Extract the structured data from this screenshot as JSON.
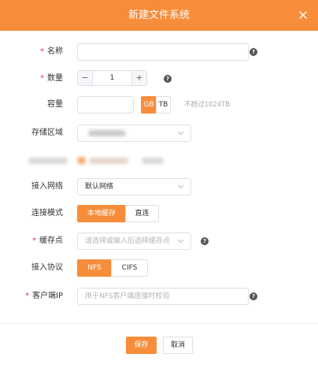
{
  "dialog": {
    "title": "新建文件系统",
    "close_icon": "close-icon"
  },
  "form": {
    "name": {
      "label": "名称",
      "required": true,
      "value": "",
      "help_icon": "help-icon"
    },
    "quantity": {
      "label": "数量",
      "required": true,
      "value": "1",
      "minus": "−",
      "plus": "+",
      "help_icon": "help-icon"
    },
    "capacity": {
      "label": "容量",
      "value": "",
      "units": [
        "GB",
        "TB"
      ],
      "selected_unit": "GB",
      "hint": "不超过1024TB"
    },
    "region": {
      "label": "存储区域",
      "value": "",
      "chevron_icon": "chevron-down-icon"
    },
    "network": {
      "label": "接入网络",
      "value": "默认网络",
      "chevron_icon": "chevron-down-icon"
    },
    "connection_mode": {
      "label": "连接模式",
      "options": [
        "本地缓存",
        "直连"
      ],
      "selected": "本地缓存"
    },
    "cache_point": {
      "label": "缓存点",
      "required": true,
      "placeholder": "请选择或输入后选择缓存点",
      "chevron_icon": "chevron-down-icon",
      "help_icon": "help-icon"
    },
    "protocol": {
      "label": "接入协议",
      "options": [
        "NFS",
        "CIFS"
      ],
      "selected": "NFS"
    },
    "client_ip": {
      "label": "客户端IP",
      "required": true,
      "placeholder": "用于NFS客户端连接时校验",
      "help_icon": "help-icon"
    }
  },
  "footer": {
    "save_label": "保存",
    "cancel_label": "取消"
  },
  "colors": {
    "accent": "#f78d3a",
    "required": "#e6393f",
    "border": "#dcdfe6"
  }
}
